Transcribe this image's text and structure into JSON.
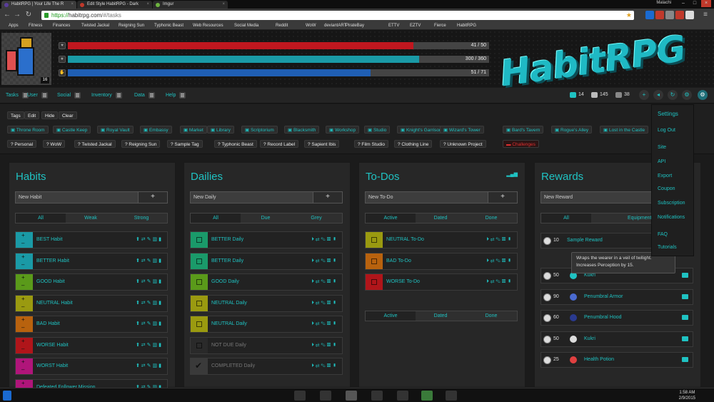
{
  "browser": {
    "tabs": [
      {
        "title": "HabitRPG | Your Life The R",
        "color": "#5a3d9a"
      },
      {
        "title": "Edit Style HabitRPG - Dark",
        "color": "#c0392b"
      },
      {
        "title": "Imgur",
        "color": "#6db33f"
      }
    ],
    "user": "Malachi",
    "url_scheme": "https://",
    "url_host": "habitrpg.com",
    "url_path": "/#/tasks",
    "bookmarks": [
      "Apps",
      "Fitness",
      "Finances",
      "Twisted Jackal",
      "Reigning Sun",
      "Typhonic Beast",
      "Web Resources",
      "Social Media",
      "Reddit",
      "WoW",
      "deviantART",
      "PirateBay",
      "ETTV",
      "EZTV",
      "Fierce",
      "HabitRPG"
    ]
  },
  "header": {
    "level": "16",
    "hp": {
      "text": "41 / 50",
      "value": 41,
      "max": 50,
      "color": "#c0171f"
    },
    "xp": {
      "text": "300 / 360",
      "value": 300,
      "max": 360,
      "color": "#1a9aa6"
    },
    "mp": {
      "text": "51 / 71",
      "value": 51,
      "max": 71,
      "color": "#1f5fb4"
    },
    "logo": "HabitRPG"
  },
  "menu": {
    "items": [
      "Tasks",
      "User",
      "Social",
      "Inventory",
      "Data",
      "Help"
    ],
    "gems": "14",
    "gold": "145",
    "silver": "38"
  },
  "tags": {
    "controls": [
      "Tags",
      "Edit",
      "Hide",
      "Clear"
    ],
    "row1": [
      "Throne Room",
      "Castle Keep",
      "Royal Vault",
      "Embassy",
      "Market",
      "Library",
      "Scriptorium",
      "Blacksmith",
      "Workshop",
      "Studio",
      "Knight's Garrison",
      "Wizard's Tower",
      "Bard's Tavern",
      "Rogue's Alley",
      "Lost in the Castle"
    ],
    "row2": [
      "Personal",
      "WoW",
      "Twisted Jackal",
      "Reigning Sun",
      "Sample Tag",
      "Typhonic Beast",
      "Record Label",
      "Sapient Ibis",
      "Film Studio",
      "Clothing Line",
      "Unknown Project",
      "Challenges"
    ]
  },
  "habits": {
    "title": "Habits",
    "placeholder": "New Habit",
    "add": "+",
    "filters": [
      "All",
      "Weak",
      "Strong"
    ],
    "rows": [
      {
        "label": "BEST Habit",
        "color": "#1a9aa6"
      },
      {
        "label": "BETTER Habit",
        "color": "#1a9aa6"
      },
      {
        "label": "GOOD Habit",
        "color": "#5a9a1a"
      },
      {
        "label": "NEUTRAL Habit",
        "color": "#9a9a10"
      },
      {
        "label": "BAD Habit",
        "color": "#b8620e"
      },
      {
        "label": "WORSE Habit",
        "color": "#b0151a"
      },
      {
        "label": "WORST Habit",
        "color": "#b0157a"
      },
      {
        "label": "Defeated Follower Mission",
        "color": "#b0157a"
      }
    ],
    "icons": "⬆⇄✎▥▮"
  },
  "dailies": {
    "title": "Dailies",
    "placeholder": "New Daily",
    "add": "+",
    "filters": [
      "All",
      "Due",
      "Grey"
    ],
    "rows": [
      {
        "label": "BETTER Daily",
        "color": "#1a9a6a",
        "dim": false
      },
      {
        "label": "BETTER Daily",
        "color": "#1a9a6a",
        "dim": false
      },
      {
        "label": "GOOD Daily",
        "color": "#5a9a1a",
        "dim": false
      },
      {
        "label": "NEUTRAL Daily",
        "color": "#9a9a10",
        "dim": false
      },
      {
        "label": "NEUTRAL Daily",
        "color": "#9a9a10",
        "dim": false
      },
      {
        "label": "NOT DUE Daily",
        "color": "#2a2a2a",
        "dim": true
      },
      {
        "label": "COMPLETED Daily",
        "color": "#3a3a3a",
        "dim": true
      }
    ],
    "icons": "⏵⇄✎▥▮"
  },
  "todos": {
    "title": "To-Dos",
    "placeholder": "New To-Do",
    "add": "+",
    "filters": [
      "Active",
      "Dated",
      "Done"
    ],
    "rows": [
      {
        "label": "NEUTRAL To-Do",
        "color": "#9a9a10"
      },
      {
        "label": "BAD To-Do",
        "color": "#b8620e"
      },
      {
        "label": "WORSE To-Do",
        "color": "#b0151a"
      }
    ],
    "icons": "⏵⇄✎▥▮"
  },
  "rewards": {
    "title": "Rewards",
    "placeholder": "New Reward",
    "filters": [
      "All",
      "Equipment &"
    ],
    "custom": {
      "price": "10",
      "label": "Sample Reward"
    },
    "items": [
      {
        "price": "50",
        "label": "Kukri",
        "color": "#1fc2c2"
      },
      {
        "price": "90",
        "label": "Penumbral Armor",
        "color": "#4a6ad0"
      },
      {
        "price": "60",
        "label": "Penumbral Hood",
        "color": "#2a3a90"
      },
      {
        "price": "50",
        "label": "Kukri",
        "color": "#dddddd"
      },
      {
        "price": "25",
        "label": "Health Potion",
        "color": "#e04040"
      }
    ],
    "tooltip": "Wraps the wearer in a veil of twilight. Increases Perception by 15."
  },
  "settings_menu": {
    "heading": "Settings",
    "items": [
      "Log Out",
      "Site",
      "API",
      "Export",
      "Coupon",
      "Subscription",
      "Notifications",
      "FAQ",
      "Tutorials"
    ]
  },
  "taskbar": {
    "time": "1:58 AM",
    "date": "2/9/2015"
  }
}
